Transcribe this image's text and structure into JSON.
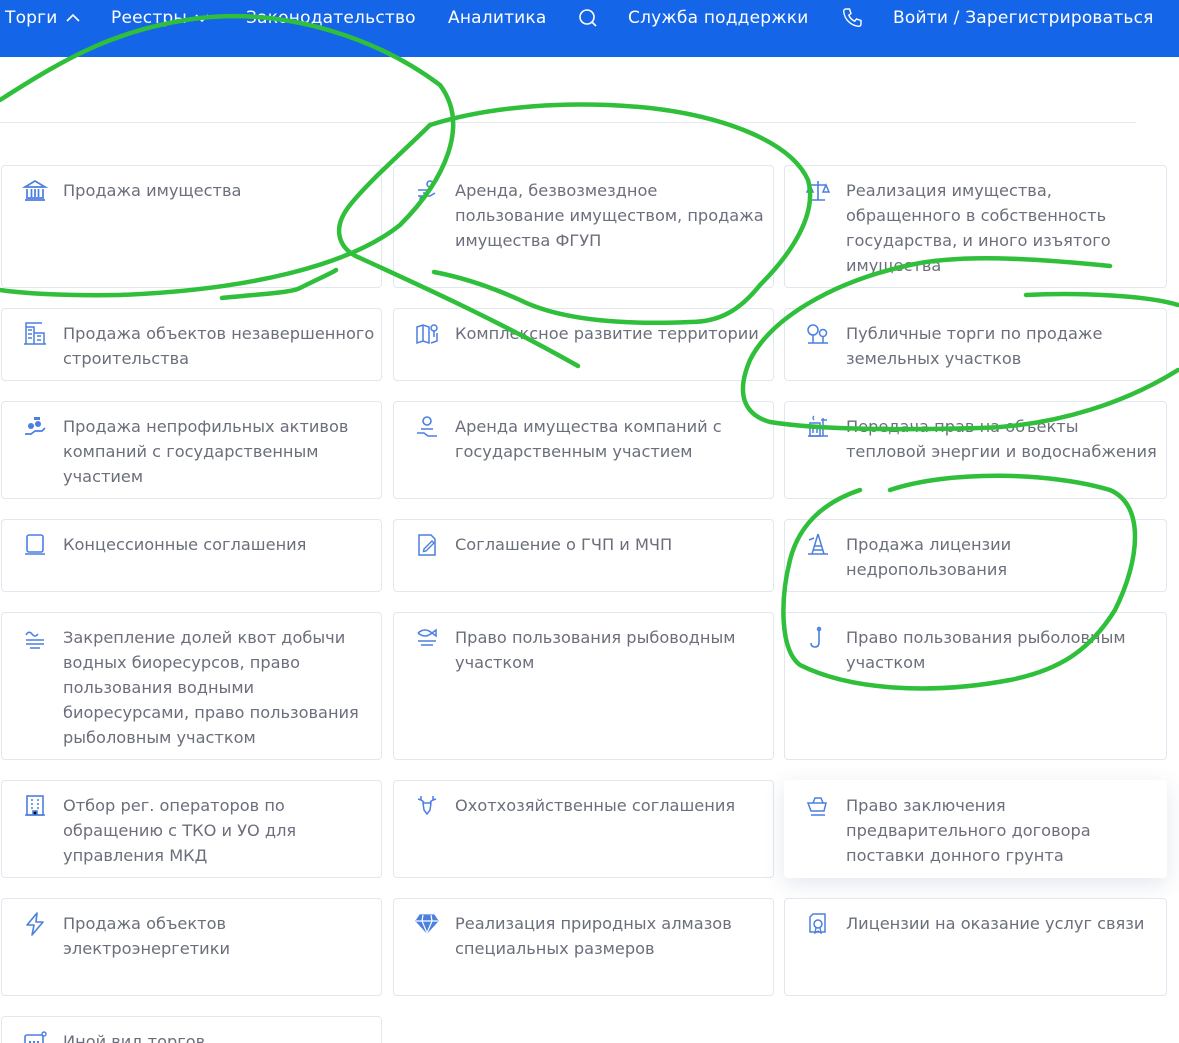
{
  "nav": {
    "auctions": "Торги",
    "registries": "Реестры",
    "legislation": "Законодательство",
    "analytics": "Аналитика",
    "support": "Служба поддержки",
    "login": "Войти / Зарегистрироваться"
  },
  "categories": [
    {
      "icon": "bank-building-icon",
      "label": "Продажа имущества"
    },
    {
      "icon": "hands-exchange-icon",
      "label": "Аренда, безвозмездное пользование имуществом, продажа имущества ФГУП"
    },
    {
      "icon": "scales-icon",
      "label": "Реализация имущества, обращенного в собственность государства, и иного изъятого имущества"
    },
    {
      "icon": "unfinished-building-icon",
      "label": "Продажа объектов незавершенного строительства"
    },
    {
      "icon": "map-pin-icon",
      "label": "Комплексное развитие территории"
    },
    {
      "icon": "trees-icon",
      "label": "Публичные торги по продаже земельных участков"
    },
    {
      "icon": "coins-hand-icon",
      "label": "Продажа непрофильных активов компаний с государственным участием"
    },
    {
      "icon": "person-hand-icon",
      "label": "Аренда имущества компаний с государственным участием"
    },
    {
      "icon": "heating-water-icon",
      "label": "Передача прав на объекты тепловой энергии и водоснабжения"
    },
    {
      "icon": "concession-document-icon",
      "label": "Концессионные соглашения"
    },
    {
      "icon": "contract-pen-icon",
      "label": "Соглашение о ГЧП и МЧП"
    },
    {
      "icon": "oil-rig-icon",
      "label": "Продажа лицензии недропользования"
    },
    {
      "icon": "waves-icon",
      "label": "Закрепление долей квот добычи водных биоресурсов, право пользования водными биоресурсами, право пользования рыболовным участком"
    },
    {
      "icon": "fish-icon",
      "label": "Право пользования рыбоводным участком"
    },
    {
      "icon": "fishing-hook-icon",
      "label": "Право пользования рыболовным участком"
    },
    {
      "icon": "apartment-building-icon",
      "label": "Отбор рег. операторов по обращению с ТКО и УО для управления МКД"
    },
    {
      "icon": "deer-icon",
      "label": "Охотхозяйственные соглашения"
    },
    {
      "icon": "excavator-bucket-icon",
      "label": "Право заключения предварительного договора поставки донного грунта"
    },
    {
      "icon": "lightning-icon",
      "label": "Продажа объектов электроэнергетики"
    },
    {
      "icon": "diamond-icon",
      "label": "Реализация природных алмазов специальных размеров"
    },
    {
      "icon": "license-badge-icon",
      "label": "Лицензии на оказание услуг связи"
    },
    {
      "icon": "other-grid-icon",
      "label": "Иной вид торгов"
    }
  ],
  "colors": {
    "header": "#1565e8",
    "icon": "#4b7fe0",
    "text": "#6b6f7b",
    "border": "#e2e7ef",
    "annotation": "#2fbf3a"
  }
}
